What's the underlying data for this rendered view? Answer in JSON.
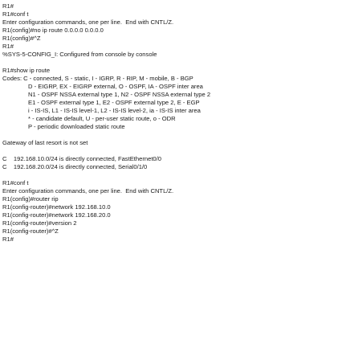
{
  "terminal": {
    "lines": [
      {
        "text": "R1#",
        "indent": 0
      },
      {
        "text": "R1#conf t",
        "indent": 0
      },
      {
        "text": "Enter configuration commands, one per line.  End with CNTL/Z.",
        "indent": 0
      },
      {
        "text": "R1(config)#no ip route 0.0.0.0 0.0.0.0",
        "indent": 0
      },
      {
        "text": "R1(config)#^Z",
        "indent": 0
      },
      {
        "text": "R1#",
        "indent": 0
      },
      {
        "text": "%SYS-5-CONFIG_I: Configured from console by console",
        "indent": 0
      },
      {
        "text": "",
        "indent": 0
      },
      {
        "text": "R1#show ip route",
        "indent": 0
      },
      {
        "text": "Codes: C - connected, S - static, I - IGRP, R - RIP, M - mobile, B - BGP",
        "indent": 0
      },
      {
        "text": "D - EIGRP, EX - EIGRP external, O - OSPF, IA - OSPF inter area",
        "indent": 1
      },
      {
        "text": "N1 - OSPF NSSA external type 1, N2 - OSPF NSSA external type 2",
        "indent": 1
      },
      {
        "text": "E1 - OSPF external type 1, E2 - OSPF external type 2, E - EGP",
        "indent": 1
      },
      {
        "text": "i - IS-IS, L1 - IS-IS level-1, L2 - IS-IS level-2, ia - IS-IS inter area",
        "indent": 1
      },
      {
        "text": "* - candidate default, U - per-user static route, o - ODR",
        "indent": 1
      },
      {
        "text": "P - periodic downloaded static route",
        "indent": 1
      },
      {
        "text": "",
        "indent": 0
      },
      {
        "text": "Gateway of last resort is not set",
        "indent": 0
      },
      {
        "text": "",
        "indent": 0
      },
      {
        "text": "C    192.168.10.0/24 is directly connected, FastEthernet0/0",
        "indent": 0
      },
      {
        "text": "C    192.168.20.0/24 is directly connected, Serial0/1/0",
        "indent": 0
      },
      {
        "text": "",
        "indent": 0
      },
      {
        "text": "R1#conf t",
        "indent": 0
      },
      {
        "text": "Enter configuration commands, one per line.  End with CNTL/Z.",
        "indent": 0
      },
      {
        "text": "R1(config)#router rip",
        "indent": 0
      },
      {
        "text": "R1(config-router)#network 192.168.10.0",
        "indent": 0
      },
      {
        "text": "R1(config-router)#network 192.168.20.0",
        "indent": 0
      },
      {
        "text": "R1(config-router)#version 2",
        "indent": 0
      },
      {
        "text": "R1(config-router)#^Z",
        "indent": 0
      },
      {
        "text": "R1#",
        "indent": 0
      }
    ]
  }
}
